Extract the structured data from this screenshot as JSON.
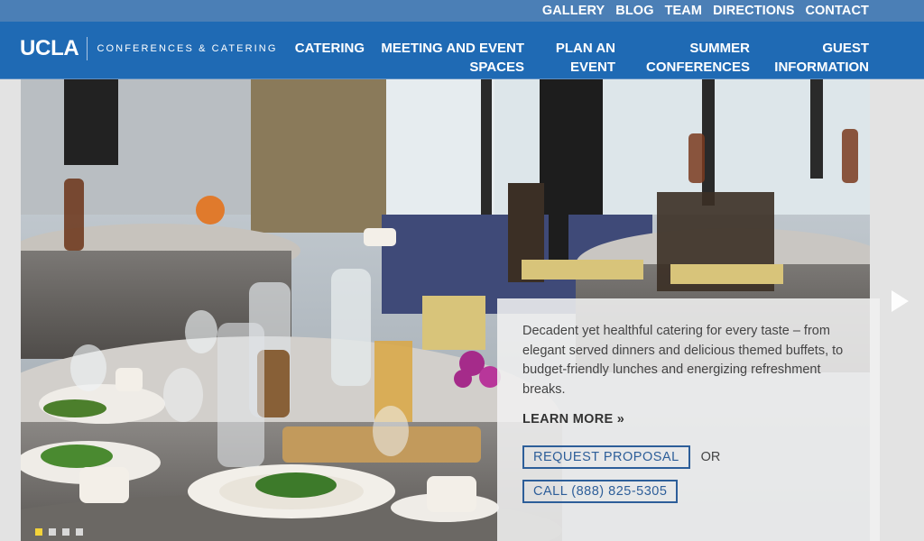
{
  "utility_nav": {
    "items": [
      {
        "label": "GALLERY"
      },
      {
        "label": "BLOG"
      },
      {
        "label": "TEAM"
      },
      {
        "label": "DIRECTIONS"
      },
      {
        "label": "CONTACT"
      }
    ]
  },
  "header": {
    "logo_main": "UCLA",
    "logo_sub": "CONFERENCES & CATERING",
    "nav": {
      "catering": "CATERING",
      "meeting_event_spaces": "MEETING AND EVENT SPACES",
      "plan_an_event": "PLAN AN EVENT",
      "summer_conferences": "SUMMER CONFERENCES",
      "guest_information": "GUEST INFORMATION"
    }
  },
  "hero": {
    "image_icon": "banquet-photo",
    "caption": {
      "text": "Decadent yet healthful catering for every taste – from elegant served dinners and delicious themed buffets, to budget-friendly lunches and energizing refreshment breaks.",
      "learn_more": "LEARN MORE »",
      "request_proposal": "REQUEST PROPOSAL",
      "or": "OR",
      "call": "CALL (888) 825-5305"
    },
    "slides": {
      "count": 4,
      "active": 1
    }
  },
  "colors": {
    "utility_bar": "#4b7fb6",
    "header": "#1f6ab4",
    "cta_border": "#2d5e99",
    "active_dot": "#f3d33a"
  }
}
